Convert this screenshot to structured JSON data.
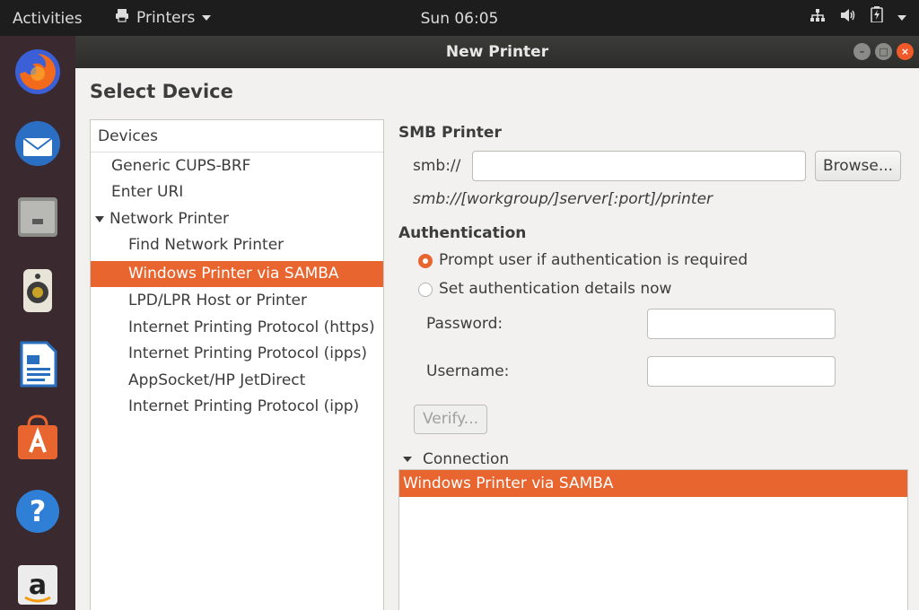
{
  "topbar": {
    "activities": "Activities",
    "app_menu": "Printers",
    "clock": "Sun 06:05"
  },
  "dock": {
    "items": [
      "firefox-icon",
      "thunderbird-icon",
      "files-icon",
      "rhythmbox-icon",
      "libreoffice-writer-icon",
      "ubuntu-software-icon",
      "help-icon",
      "amazon-icon"
    ]
  },
  "window": {
    "title": "New Printer",
    "heading": "Select Device"
  },
  "devices": {
    "header": "Devices",
    "items": [
      "Generic CUPS-BRF",
      "Enter URI",
      "Network Printer",
      "Find Network Printer",
      "Windows Printer via SAMBA",
      "LPD/LPR Host or Printer",
      "Internet Printing Protocol (https)",
      "Internet Printing Protocol (ipps)",
      "AppSocket/HP JetDirect",
      "Internet Printing Protocol (ipp)"
    ],
    "selected": "Windows Printer via SAMBA"
  },
  "smb": {
    "title": "SMB Printer",
    "prefix": "smb://",
    "value": "",
    "browse_label": "Browse...",
    "hint": "smb://[workgroup/]server[:port]/printer"
  },
  "auth": {
    "title": "Authentication",
    "option_prompt": "Prompt user if authentication is required",
    "option_set": "Set authentication details now",
    "selected": "prompt",
    "password_label": "Password:",
    "password_value": "",
    "username_label": "Username:",
    "username_value": "",
    "verify_label": "Verify..."
  },
  "connection": {
    "label": "Connection",
    "items": [
      "Windows Printer via SAMBA"
    ]
  },
  "colors": {
    "accent": "#e9652f",
    "topbar": "#1d1d1d",
    "dock": "#3a2a30",
    "window_bg": "#f2f1f0"
  }
}
